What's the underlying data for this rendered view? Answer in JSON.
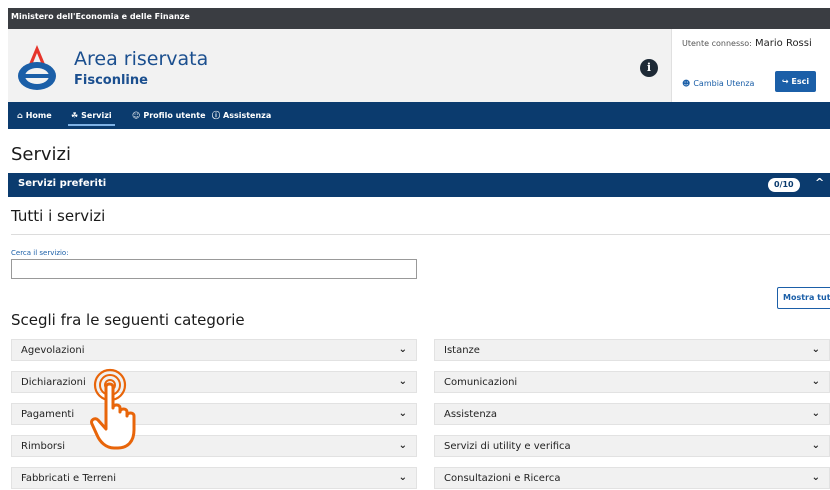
{
  "topbar": {
    "ministry": "Ministero dell'Economia e delle Finanze"
  },
  "header": {
    "title": "Area riservata",
    "subtitle": "Fisconline",
    "info_icon": "i",
    "user_label": "Utente connesso:",
    "user_name": "Mario Rossi",
    "change_user": "Cambia Utenza",
    "logout": "Esci"
  },
  "nav": {
    "items": [
      {
        "label": "Home",
        "icon": "home-icon",
        "glyph": "⌂"
      },
      {
        "label": "Servizi",
        "icon": "services-icon",
        "glyph": "☘"
      },
      {
        "label": "Profilo utente",
        "icon": "user-icon",
        "glyph": "☺"
      },
      {
        "label": "Assistenza",
        "icon": "info-circle-icon",
        "glyph": "ⓘ"
      }
    ],
    "active": "Servizi"
  },
  "main": {
    "page_title": "Servizi",
    "favorites": {
      "label": "Servizi preferiti",
      "count": "0/10"
    },
    "all_services_title": "Tutti i servizi",
    "search": {
      "label": "Cerca il servizio:",
      "value": "",
      "placeholder": ""
    },
    "show_all_label": "Mostra tutti",
    "categories_title": "Scegli fra le seguenti categorie",
    "categories_left": [
      "Agevolazioni",
      "Dichiarazioni",
      "Pagamenti",
      "Rimborsi",
      "Fabbricati e Terreni"
    ],
    "categories_right": [
      "Istanze",
      "Comunicazioni",
      "Assistenza",
      "Servizi di utility e verifica",
      "Consultazioni e Ricerca"
    ]
  },
  "colors": {
    "nav_blue": "#0b3b6e",
    "link_blue": "#1b5fa8",
    "hand_orange": "#e8650a"
  }
}
